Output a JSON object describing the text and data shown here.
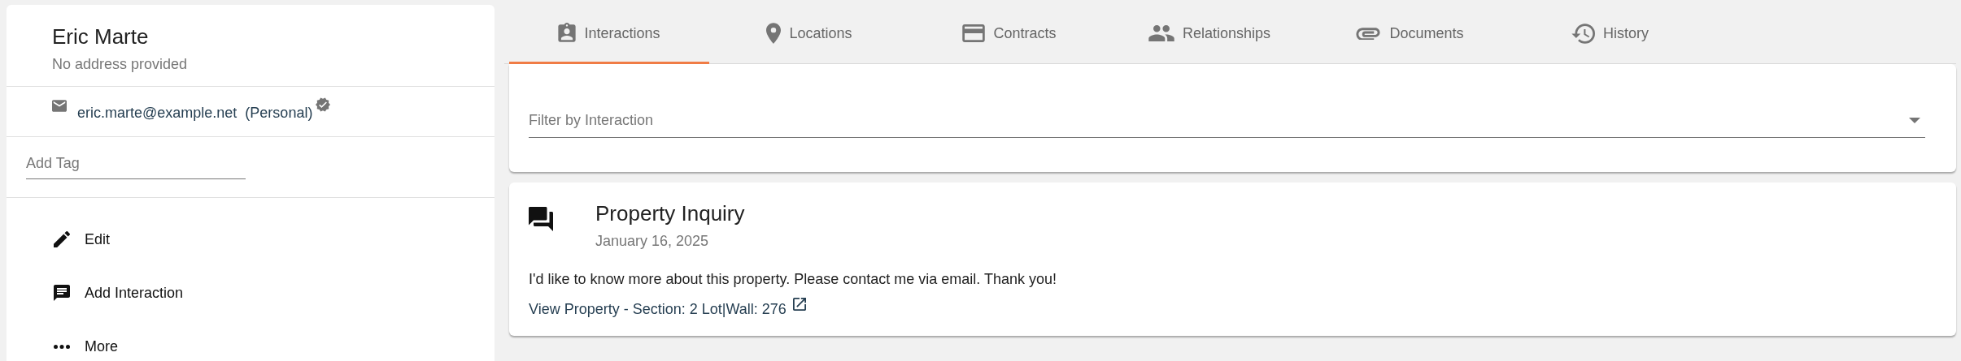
{
  "contact": {
    "name": "Eric Marte",
    "address": "No address provided",
    "email": "eric.marte@example.net",
    "email_type": "(Personal)",
    "verified": true,
    "tag_field": {
      "placeholder": "Add Tag"
    }
  },
  "actions": [
    {
      "kind": "edit",
      "label": "Edit"
    },
    {
      "kind": "interaction",
      "label": "Add Interaction"
    },
    {
      "kind": "more",
      "label": "More"
    }
  ],
  "tabs": [
    {
      "kind": "interactions",
      "label": "Interactions",
      "selected": true
    },
    {
      "kind": "locations",
      "label": "Locations",
      "selected": false
    },
    {
      "kind": "contracts",
      "label": "Contracts",
      "selected": false
    },
    {
      "kind": "relationships",
      "label": "Relationships",
      "selected": false
    },
    {
      "kind": "documents",
      "label": "Documents",
      "selected": false
    },
    {
      "kind": "history",
      "label": "History",
      "selected": false
    }
  ],
  "filter": {
    "placeholder": "Filter by Interaction"
  },
  "interactions": [
    {
      "title": "Property Inquiry",
      "date": "January 16, 2025",
      "message": "I'd like to know more about this property. Please contact me via email. Thank you!",
      "link": "View Property - Section: 2 Lot|Wall: 276"
    }
  ]
}
